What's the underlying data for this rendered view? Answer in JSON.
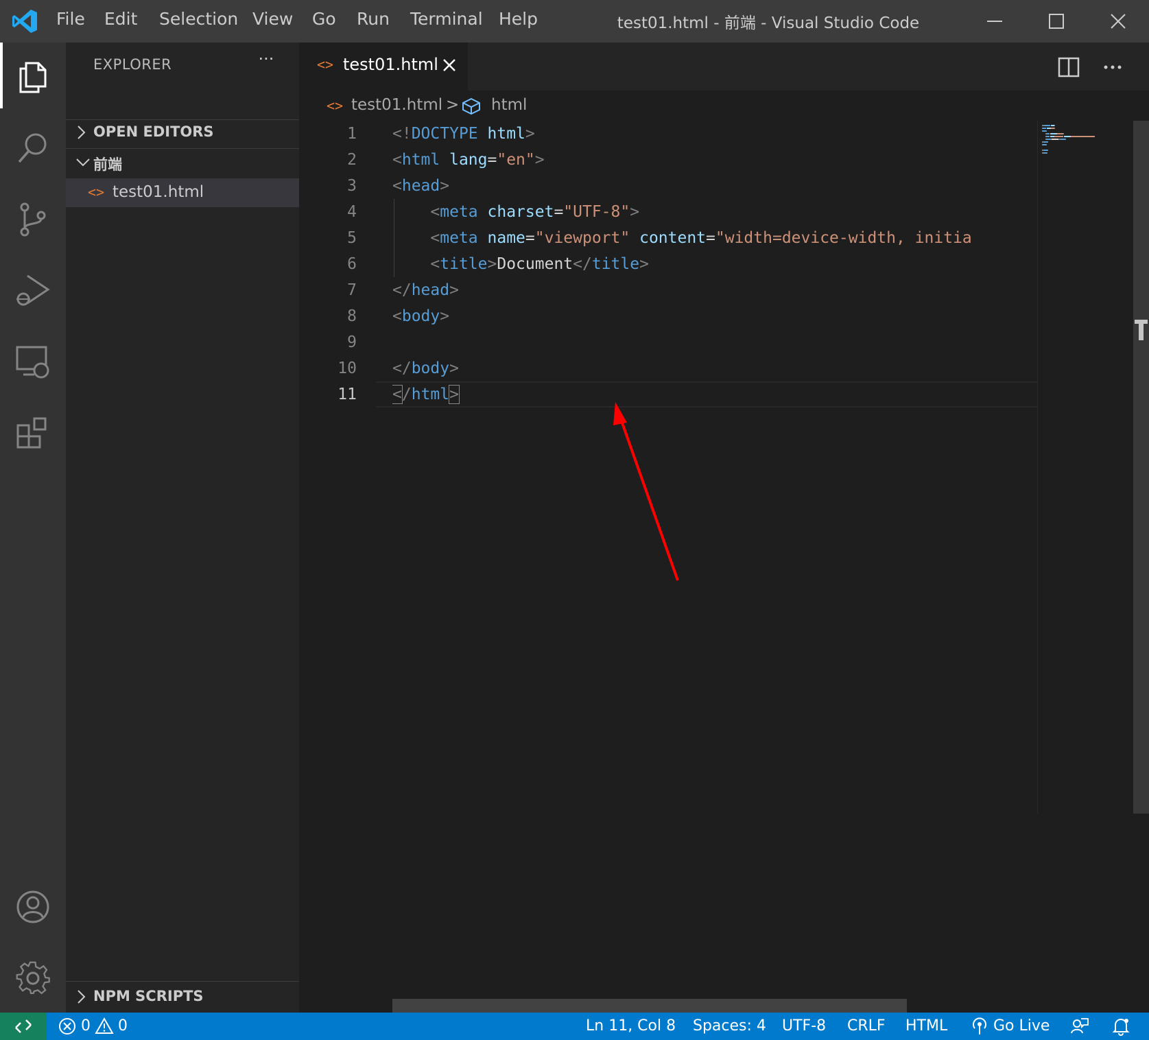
{
  "titlebar": {
    "menu": [
      "File",
      "Edit",
      "Selection",
      "View",
      "Go",
      "Run",
      "Terminal",
      "Help"
    ],
    "window_title": "test01.html - 前端 - Visual Studio Code"
  },
  "activity_bar": {
    "items": [
      "explorer",
      "search",
      "source-control",
      "run-and-debug",
      "remote-explorer",
      "extensions"
    ],
    "bottom": [
      "accounts",
      "manage"
    ],
    "active": "explorer"
  },
  "sidebar": {
    "title": "EXPLORER",
    "more": "···",
    "sections": {
      "open_editors": "OPEN EDITORS",
      "folder": "前端",
      "npm_scripts": "NPM SCRIPTS"
    },
    "files": [
      {
        "icon": "<>",
        "name": "test01.html"
      }
    ]
  },
  "tabs": [
    {
      "icon": "<>",
      "label": "test01.html",
      "active": true
    }
  ],
  "breadcrumb": {
    "file": "test01.html",
    "separator": ">",
    "symbol": "html"
  },
  "editor": {
    "line_numbers": [
      "1",
      "2",
      "3",
      "4",
      "5",
      "6",
      "7",
      "8",
      "9",
      "10",
      "11"
    ],
    "active_line": 11,
    "lines": [
      [
        {
          "t": "punc",
          "v": "<!"
        },
        {
          "t": "tag",
          "v": "DOCTYPE"
        },
        {
          "t": "text",
          "v": " "
        },
        {
          "t": "attr",
          "v": "html"
        },
        {
          "t": "punc",
          "v": ">"
        }
      ],
      [
        {
          "t": "punc",
          "v": "<"
        },
        {
          "t": "tag",
          "v": "html"
        },
        {
          "t": "text",
          "v": " "
        },
        {
          "t": "attr",
          "v": "lang"
        },
        {
          "t": "text",
          "v": "="
        },
        {
          "t": "str",
          "v": "\"en\""
        },
        {
          "t": "punc",
          "v": ">"
        }
      ],
      [
        {
          "t": "punc",
          "v": "<"
        },
        {
          "t": "tag",
          "v": "head"
        },
        {
          "t": "punc",
          "v": ">"
        }
      ],
      [
        {
          "t": "text",
          "v": "    "
        },
        {
          "t": "punc",
          "v": "<"
        },
        {
          "t": "tag",
          "v": "meta"
        },
        {
          "t": "text",
          "v": " "
        },
        {
          "t": "attr",
          "v": "charset"
        },
        {
          "t": "text",
          "v": "="
        },
        {
          "t": "str",
          "v": "\"UTF-8\""
        },
        {
          "t": "punc",
          "v": ">"
        }
      ],
      [
        {
          "t": "text",
          "v": "    "
        },
        {
          "t": "punc",
          "v": "<"
        },
        {
          "t": "tag",
          "v": "meta"
        },
        {
          "t": "text",
          "v": " "
        },
        {
          "t": "attr",
          "v": "name"
        },
        {
          "t": "text",
          "v": "="
        },
        {
          "t": "str",
          "v": "\"viewport\""
        },
        {
          "t": "text",
          "v": " "
        },
        {
          "t": "attr",
          "v": "content"
        },
        {
          "t": "text",
          "v": "="
        },
        {
          "t": "str",
          "v": "\"width=device-width, initia"
        }
      ],
      [
        {
          "t": "text",
          "v": "    "
        },
        {
          "t": "punc",
          "v": "<"
        },
        {
          "t": "tag",
          "v": "title"
        },
        {
          "t": "punc",
          "v": ">"
        },
        {
          "t": "text",
          "v": "Document"
        },
        {
          "t": "punc",
          "v": "</"
        },
        {
          "t": "tag",
          "v": "title"
        },
        {
          "t": "punc",
          "v": ">"
        }
      ],
      [
        {
          "t": "punc",
          "v": "</"
        },
        {
          "t": "tag",
          "v": "head"
        },
        {
          "t": "punc",
          "v": ">"
        }
      ],
      [
        {
          "t": "punc",
          "v": "<"
        },
        {
          "t": "tag",
          "v": "body"
        },
        {
          "t": "punc",
          "v": ">"
        }
      ],
      [],
      [
        {
          "t": "punc",
          "v": "</"
        },
        {
          "t": "tag",
          "v": "body"
        },
        {
          "t": "punc",
          "v": ">"
        }
      ],
      [
        {
          "t": "punc",
          "v": "<",
          "hl": true
        },
        {
          "t": "punc",
          "v": "/"
        },
        {
          "t": "tag",
          "v": "html"
        },
        {
          "t": "punc",
          "v": ">",
          "hl": true
        }
      ]
    ]
  },
  "statusbar": {
    "errors": "0",
    "warnings": "0",
    "position": "Ln 11, Col 8",
    "spaces": "Spaces: 4",
    "encoding": "UTF-8",
    "eol": "CRLF",
    "language": "HTML",
    "go_live": "Go Live"
  },
  "colors": {
    "accent": "#007acc",
    "remote": "#16825d",
    "html_icon": "#e37933",
    "annotation_arrow": "#ff0000"
  },
  "annotation": {
    "type": "red-arrow",
    "target": "line-11"
  }
}
